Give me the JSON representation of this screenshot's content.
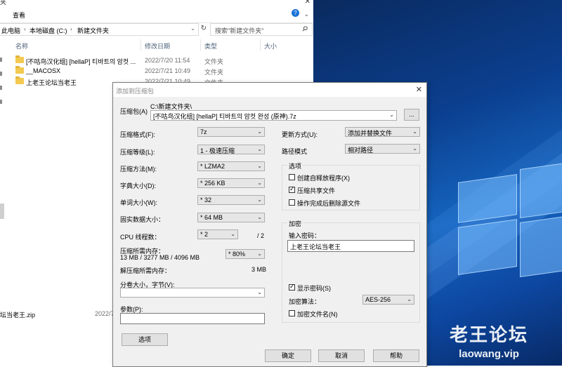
{
  "explorer": {
    "titlebar_fragment": "夹",
    "ribbon_tab_view": "查看",
    "breadcrumb": [
      "此电脑",
      "本地磁盘 (C:)",
      "新建文件夹"
    ],
    "search_placeholder": "搜索\"新建文件夹\"",
    "columns": [
      "名称",
      "修改日期",
      "类型",
      "大小"
    ],
    "rows": [
      {
        "name": "[不咕鸟汉化组] [hellaP] 티바트의 암컷 ...",
        "date": "2022/7/20 11:54",
        "type": "文件夹"
      },
      {
        "name": "__MACOSX",
        "date": "2022/7/21 10:49",
        "type": "文件夹"
      },
      {
        "name": "上老王论坛当老王",
        "date": "2022/7/21 10:49",
        "type": "文件夹"
      }
    ],
    "zip_name_fragment": "坛当老王.zip",
    "zip_date_fragment": "2022/7"
  },
  "dialog": {
    "title": "添加到压缩包",
    "archive_label": "压缩包(A)",
    "archive_path": "C:\\新建文件夹\\",
    "archive_name": "[不咕鸟汉化组] [hellaP] 티바트의 암컷 완성 (原神).7z",
    "browse_label": "...",
    "format_label": "压缩格式(F):",
    "format_value": "7z",
    "level_label": "压缩等级(L):",
    "level_value": "1 - 极速压缩",
    "method_label": "压缩方法(M):",
    "method_value": "* LZMA2",
    "dict_label": "字典大小(D):",
    "dict_value": "* 256 KB",
    "word_label": "单词大小(W):",
    "word_value": "* 32",
    "solid_label": "固实数据大小：",
    "solid_value": "* 64 MB",
    "threads_label": "CPU 线程数：",
    "threads_value": "* 2",
    "threads_max": "/ 2",
    "mem_comp_label": "压缩所需内存：",
    "mem_comp_value": "13 MB / 3277 MB / 4096 MB",
    "mem_percent": "* 80%",
    "mem_decomp_label": "解压缩所需内存：",
    "mem_decomp_value": "3 MB",
    "split_label": "分卷大小，字节(V):",
    "params_label": "参数(P):",
    "options_button": "选项",
    "update_label": "更新方式(U):",
    "update_value": "添加并替换文件",
    "path_mode_label": "路径模式",
    "path_mode_value": "相对路径",
    "options_group": "选项",
    "opt_sfx": "创建自释放程序(X)",
    "opt_shared": "压缩共享文件",
    "opt_delete": "操作完成后删除源文件",
    "enc_group": "加密",
    "password_label": "输入密码：",
    "password_value": "上老王论坛当老王",
    "show_password": "显示密码(S)",
    "enc_method_label": "加密算法：",
    "enc_method_value": "AES-256",
    "enc_names": "加密文件名(N)",
    "ok": "确定",
    "cancel": "取消",
    "help": "帮助"
  },
  "watermark": {
    "title": "老王论坛",
    "url": "laowang.vip"
  }
}
